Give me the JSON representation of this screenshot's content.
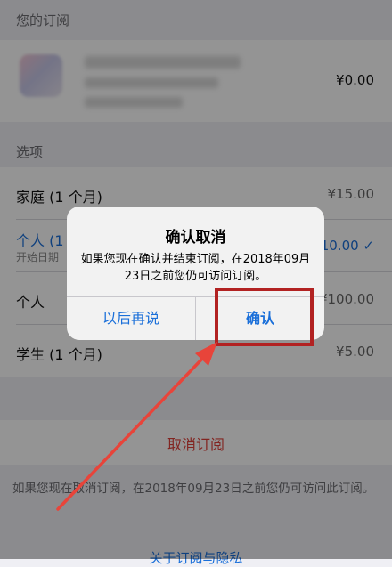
{
  "subscription": {
    "section_title": "您的订阅",
    "price": "¥0.00"
  },
  "options": {
    "section_title": "选项",
    "items": [
      {
        "label": "家庭 (1 个月)",
        "value": "¥15.00"
      },
      {
        "label": "个人 (1",
        "sub": "开始日期",
        "value": "10.00 ✓"
      },
      {
        "label": "个人",
        "value": "¥100.00"
      },
      {
        "label": "学生 (1 个月)",
        "value": "¥5.00"
      }
    ]
  },
  "cancel_subscription_label": "取消订阅",
  "footnote": "如果您现在取消订阅，在2018年09月23日之前您仍可访问此订阅。",
  "bottom_link": "关于订阅与隐私",
  "alert": {
    "title": "确认取消",
    "message": "如果您现在确认并结束订阅，在2018年09月23日之前您仍可访问订阅。",
    "later_button": "以后再说",
    "confirm_button": "确认"
  },
  "colors": {
    "accent_blue": "#1a6fd9",
    "destructive_red": "#e0413a",
    "annotation_red": "#b22222"
  }
}
